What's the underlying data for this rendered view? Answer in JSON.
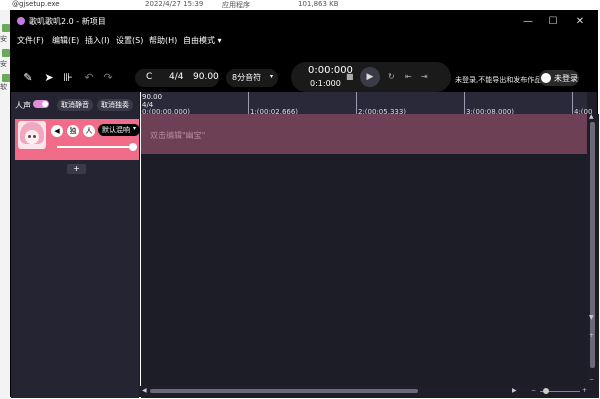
{
  "background": {
    "top_row": {
      "date": "2022/4/27 15:39",
      "type": "应用程序",
      "size": "101,863 KB",
      "file": "@gjsetup.exe"
    },
    "left_items": [
      "安",
      "安",
      "软"
    ]
  },
  "window": {
    "title": "歌叽歌叽2.0 - 新项目",
    "controls": {
      "minimize": "—",
      "maximize": "☐",
      "close": "✕"
    }
  },
  "menu": [
    "文件(F)",
    "编辑(E)",
    "插入(I)",
    "设置(S)",
    "帮助(H)",
    "自由模式 ▾"
  ],
  "toolbar": {
    "key": "C",
    "time_signature": "4/4",
    "tempo": "90.00",
    "note_value": "8分音符",
    "time_main": "0:00:000",
    "time_sub": "0:1:000",
    "notice": "未登录,不能导出和发布作品",
    "login_label": "未登录"
  },
  "tracks_panel": {
    "vocal_label": "人声",
    "unmute_label": "取消静音",
    "unsolo_label": "取消独奏",
    "reverb_label": "默认混响",
    "solo_icon_text": "独",
    "person_icon_text": "人",
    "add_label": "+",
    "volume_level": 0.95
  },
  "timeline": {
    "tempo": "90.00",
    "meter": "4/4",
    "markers": [
      "0:(00:00.000)",
      "1:(00:02.666)",
      "2:(00:05.333)",
      "3:(00:08.000)",
      "4:(00"
    ],
    "lane_hint": "双击编辑\"幽宝\""
  }
}
